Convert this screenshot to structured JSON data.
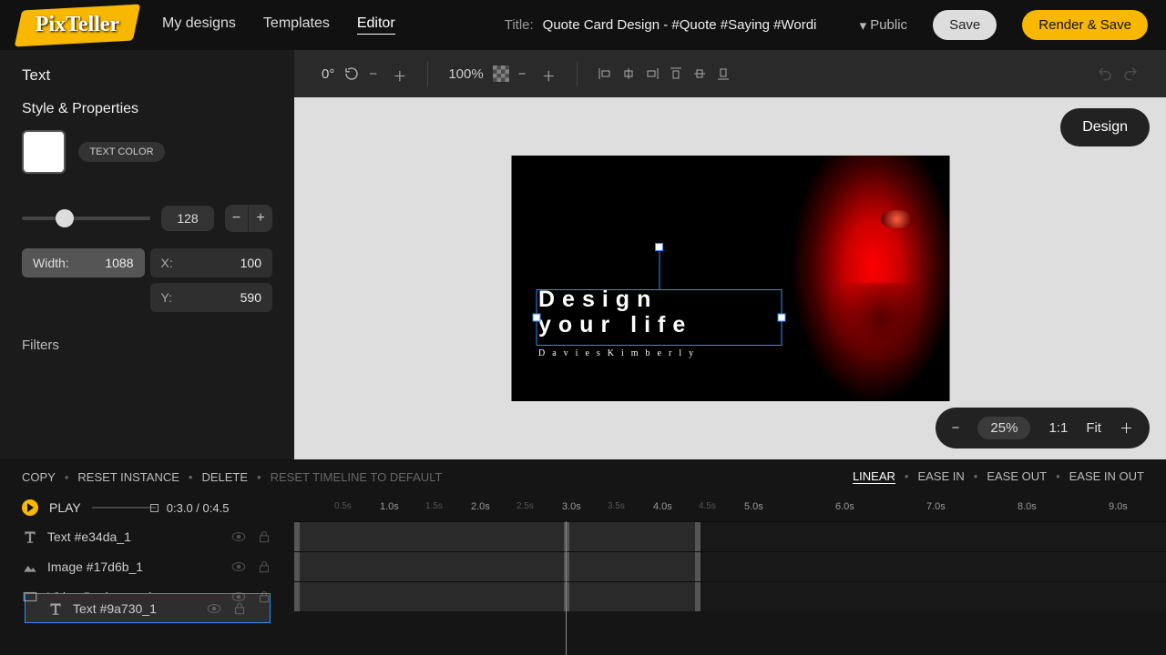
{
  "brand": "PixTeller",
  "nav": {
    "mydesigns": "My designs",
    "templates": "Templates",
    "editor": "Editor"
  },
  "title": {
    "label": "Title:",
    "value": "Quote Card Design - #Quote #Saying #Wordi"
  },
  "visibility": "Public",
  "buttons": {
    "save": "Save",
    "render": "Render & Save"
  },
  "toolbar": {
    "angle": "0°",
    "opacity": "100%"
  },
  "left": {
    "heading": "Text",
    "section": "Style & Properties",
    "textcolor_label": "TEXT COLOR",
    "size_value": "128",
    "width_label": "Width:",
    "width_value": "1088",
    "x_label": "X:",
    "x_value": "100",
    "y_label": "Y:",
    "y_value": "590",
    "filters": "Filters"
  },
  "stage": {
    "mode": "Design",
    "zoom": "25%",
    "scale": "1:1",
    "fit": "Fit",
    "quote_l1": "Design",
    "quote_l2": "your life",
    "author": "DaviesKimberly"
  },
  "timeline": {
    "actions": {
      "copy": "COPY",
      "reset_instance": "RESET INSTANCE",
      "delete": "DELETE",
      "reset_tl": "RESET TIMELINE TO DEFAULT"
    },
    "easing": {
      "linear": "LINEAR",
      "easein": "EASE IN",
      "easeout": "EASE OUT",
      "easeinout": "EASE IN OUT"
    },
    "play": "PLAY",
    "time": "0:3.0 / 0:4.5",
    "ticks_major": [
      "1.0s",
      "2.0s",
      "3.0s",
      "4.0s",
      "5.0s",
      "6.0s",
      "7.0s",
      "8.0s",
      "9.0s"
    ],
    "ticks_minor": [
      "0.5s",
      "1.5s",
      "2.5s",
      "3.5s",
      "4.5s"
    ],
    "layers": [
      {
        "name": "Text #e34da_1",
        "type": "text"
      },
      {
        "name": "Text #9a730_1",
        "type": "text",
        "selected": true
      },
      {
        "name": "Image #17d6b_1",
        "type": "image"
      },
      {
        "name": "Video Background",
        "type": "video"
      }
    ]
  }
}
